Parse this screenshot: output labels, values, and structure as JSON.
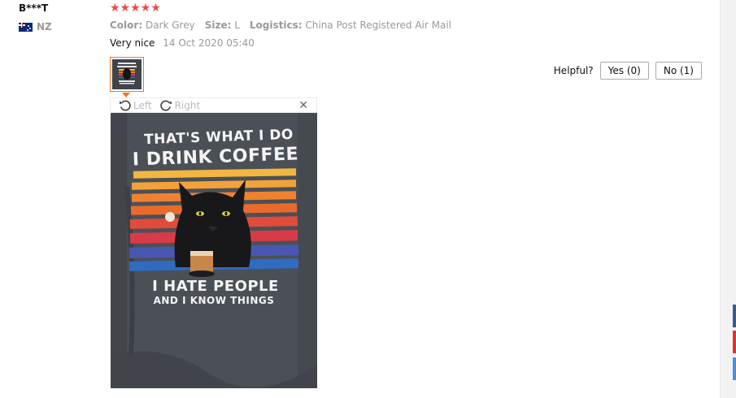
{
  "review": {
    "username": "B***T",
    "country": "NZ",
    "rating_stars": 5,
    "stars_display": "★★★★★",
    "color_label": "Color:",
    "color_value": "Dark Grey",
    "size_label": "Size:",
    "size_value": "L",
    "logistics_label": "Logistics:",
    "logistics_value": "China Post Registered Air Mail",
    "text": "Very nice",
    "date": "14 Oct 2020 05:40"
  },
  "helpful": {
    "label": "Helpful?",
    "yes_label": "Yes (0)",
    "no_label": "No (1)"
  },
  "viewer": {
    "rotate_left_label": "Left",
    "rotate_right_label": "Right",
    "close_glyph": "✕"
  },
  "photo": {
    "shirt_line1": "THAT'S WHAT I DO",
    "shirt_line2": "I DRINK COFFEE",
    "shirt_line3": "I HATE PEOPLE",
    "shirt_line4": "AND I KNOW THINGS"
  },
  "colors": {
    "star": "#f04848",
    "accent": "#f27522",
    "muted": "#999999"
  },
  "icons": {
    "rotate_left": "rotate-left-icon",
    "rotate_right": "rotate-right-icon",
    "close": "close-icon",
    "flag": "flag-icon",
    "star": "star-icon"
  }
}
